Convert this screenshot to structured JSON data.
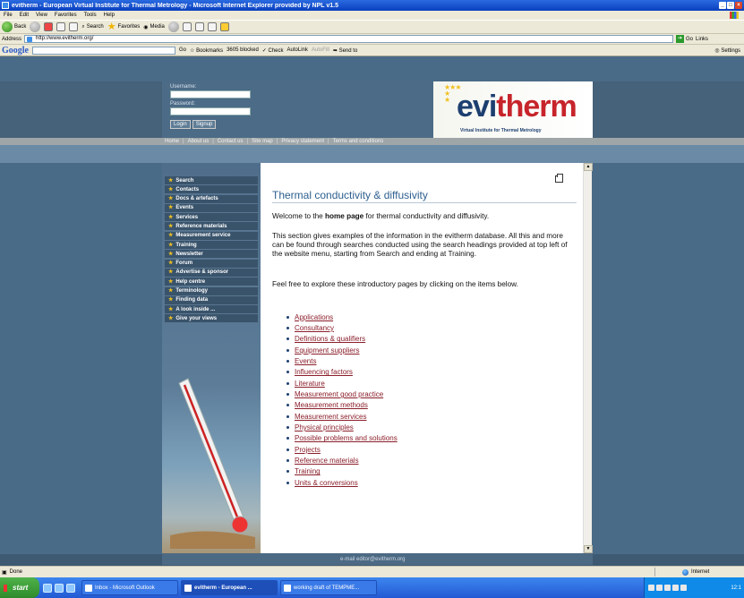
{
  "window": {
    "title": "evitherm - European Virtual Institute for Thermal Metrology - Microsoft Internet Explorer provided by NPL v1.5"
  },
  "menu": [
    "File",
    "Edit",
    "View",
    "Favorites",
    "Tools",
    "Help"
  ],
  "toolbar": {
    "back_label": "Back",
    "search_label": "Search",
    "favorites_label": "Favorites",
    "media_label": "Media"
  },
  "address": {
    "label": "Address",
    "url": "http://www.evitherm.org/",
    "go_label": "Go",
    "links_label": "Links"
  },
  "google_toolbar": {
    "logo": "Google",
    "go_label": "Go",
    "bookmarks_label": "Bookmarks",
    "blocked_label": "3605 blocked",
    "check_label": "Check",
    "autolink_label": "AutoLink",
    "autofill_label": "AutoFill",
    "sendto_label": "Send to",
    "settings_label": "Settings"
  },
  "site": {
    "login": {
      "username_label": "Username:",
      "password_label": "Password:",
      "login_button": "Login",
      "signup_button": "Signup"
    },
    "logo_text_a": "evi",
    "logo_text_b": "therm",
    "logo_tagline": "Virtual Institute for Thermal Metrology",
    "topnav": [
      "Home",
      "About us",
      "Contact us",
      "Site map",
      "Privacy statement",
      "Terms and conditions"
    ],
    "sidenav": [
      "Search",
      "Contacts",
      "Docs & artefacts",
      "Events",
      "Services",
      "Reference materials",
      "Measurement service",
      "Training",
      "Newsletter",
      "Forum",
      "Advertise & sponsor",
      "Help centre",
      "Terminology",
      "Finding data",
      "A look inside ...",
      "Give your views"
    ],
    "footer_email": "e-mail editor@evitherm.org"
  },
  "content": {
    "title": "Thermal conductivity & diffusivity",
    "intro_pre": "Welcome to the ",
    "intro_bold": "home page",
    "intro_post": " for thermal conductivity and diffusivity.",
    "para2": "This section gives examples of the information in the evitherm database. All this and more can be found through searches conducted using the search headings provided at top left of the website menu, starting from Search and ending at Training.",
    "para3": "Feel free to explore these introductory pages by clicking on the items below.",
    "links": [
      "Applications",
      "Consultancy",
      "Definitions & qualifiers",
      "Equipment suppliers",
      "Events",
      "Influencing factors",
      "Literature",
      "Measurement good practice",
      "Measurement methods",
      "Measurement services",
      "Physical principles",
      "Possible problems and solutions",
      "Projects",
      "Reference materials",
      "Training",
      "Units & conversions"
    ]
  },
  "statusbar": {
    "status": "Done",
    "zone": "Internet"
  },
  "taskbar": {
    "start_label": "start",
    "tasks": [
      "Inbox - Microsoft Outlook",
      "evitherm - European ...",
      "working draft of TEMPME..."
    ],
    "clock": "12:1"
  },
  "colors": {
    "accent": "#2d5f8f",
    "link": "#8a1e2a",
    "logo_red": "#c7242b",
    "logo_blue": "#1d3f70"
  }
}
